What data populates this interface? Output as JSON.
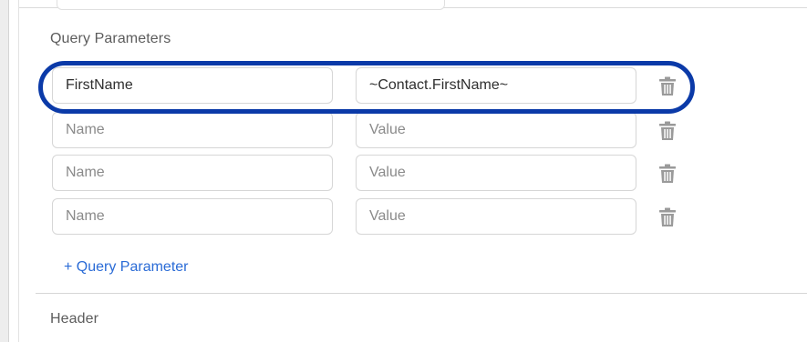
{
  "query_section": {
    "title": "Query Parameters",
    "rows": [
      {
        "name": "FirstName",
        "value": "~Contact.FirstName~",
        "name_is_placeholder": false,
        "value_is_placeholder": false
      },
      {
        "name": "Name",
        "value": "Value",
        "name_is_placeholder": true,
        "value_is_placeholder": true
      },
      {
        "name": "Name",
        "value": "Value",
        "name_is_placeholder": true,
        "value_is_placeholder": true
      },
      {
        "name": "Name",
        "value": "Value",
        "name_is_placeholder": true,
        "value_is_placeholder": true
      }
    ],
    "delete_icon": "trash-icon",
    "add_label": "+ Query Parameter"
  },
  "header_section": {
    "title": "Header"
  },
  "colors": {
    "highlight": "#0b3aa8",
    "link": "#2a6bd6",
    "trash": "#9a9a9a"
  }
}
